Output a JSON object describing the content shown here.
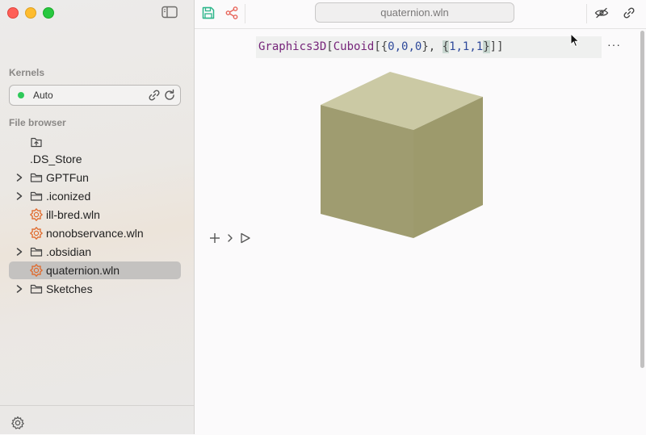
{
  "window": {
    "traffic_lights": [
      "close",
      "minimize",
      "zoom"
    ]
  },
  "sidebar": {
    "kernels_heading": "Kernels",
    "kernel": {
      "name": "Auto",
      "status_color": "#2fc95a"
    },
    "file_browser_heading": "File browser",
    "files": [
      {
        "name": ".DS_Store",
        "type": "file",
        "icon": "none"
      },
      {
        "name": "GPTFun",
        "type": "folder",
        "icon": "folder-icon"
      },
      {
        "name": ".iconized",
        "type": "folder",
        "icon": "folder-icon"
      },
      {
        "name": "ill-bred.wln",
        "type": "file",
        "icon": "wolfram-icon"
      },
      {
        "name": "nonobservance.wln",
        "type": "file",
        "icon": "wolfram-icon"
      },
      {
        "name": ".obsidian",
        "type": "folder",
        "icon": "folder-icon"
      },
      {
        "name": "quaternion.wln",
        "type": "file",
        "icon": "wolfram-icon",
        "selected": true
      },
      {
        "name": "Sketches",
        "type": "folder",
        "icon": "folder-icon"
      }
    ]
  },
  "toolbar": {
    "title": "quaternion.wln",
    "save_color": "#2bb58a",
    "share_color": "#e8655a"
  },
  "notebook": {
    "cell_input": {
      "fn1": "Graphics3D",
      "b1": "[",
      "fn2": "Cuboid",
      "b2": "[{",
      "p1": "0,0,0",
      "b3": "}, ",
      "b4": "{",
      "p2": "1,1,1",
      "b5": "}",
      "b6": "]]"
    },
    "cell_menu": "···",
    "cube_colors": {
      "top": "#cbc9a4",
      "left": "#9f9c70",
      "right": "#9d9a6c"
    }
  },
  "colors": {
    "accent": "#2bb58a",
    "wolfram_orange": "#e06a2c"
  }
}
